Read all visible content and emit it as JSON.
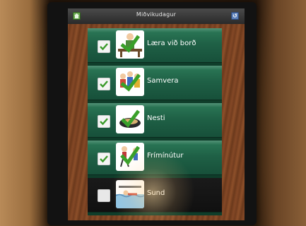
{
  "header": {
    "title": "Miðvikudagur",
    "home_icon": "home-icon",
    "back_icon": "back-icon"
  },
  "items": [
    {
      "label": "Læra við borð",
      "checked": true,
      "icon": "study-at-table-icon"
    },
    {
      "label": "Samvera",
      "checked": true,
      "icon": "group-time-icon"
    },
    {
      "label": "Nesti",
      "checked": true,
      "icon": "lunch-icon"
    },
    {
      "label": "Frímínútur",
      "checked": true,
      "icon": "recess-icon"
    },
    {
      "label": "Sund",
      "checked": false,
      "icon": "swimming-icon"
    }
  ],
  "colors": {
    "row_green": "#1f6146",
    "check_green": "#3a9a2a",
    "wood": "#7a4222"
  }
}
